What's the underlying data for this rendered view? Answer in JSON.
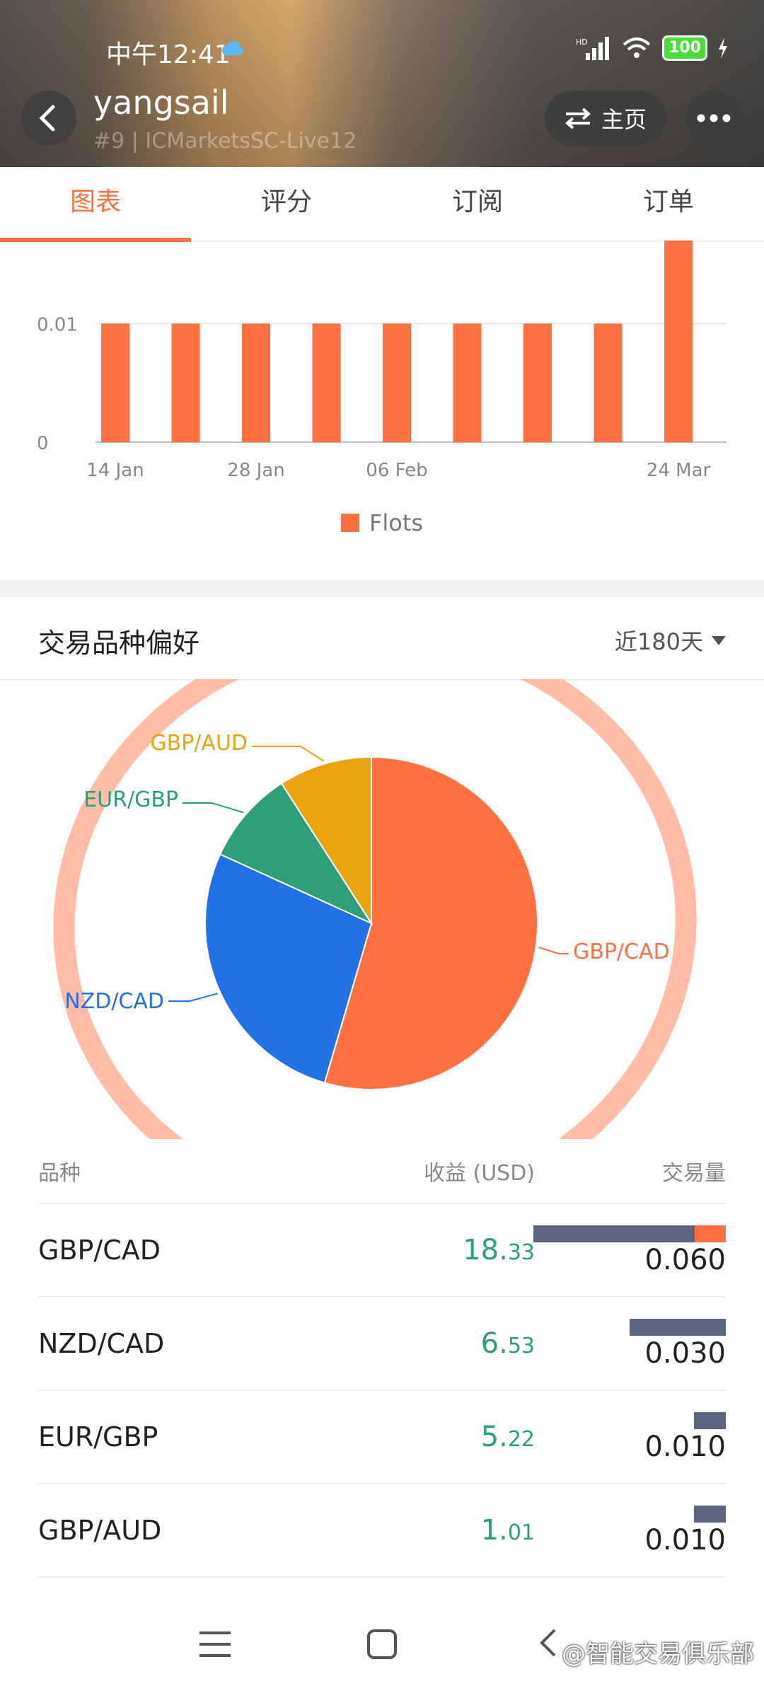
{
  "status_bar": {
    "time": "中午12:41",
    "battery": "100"
  },
  "header": {
    "username": "yangsail",
    "subtitle": "#9 | ICMarketsSC-Live12",
    "home_label": "主页"
  },
  "tabs": [
    {
      "label": "图表",
      "active": true
    },
    {
      "label": "评分",
      "active": false
    },
    {
      "label": "订阅",
      "active": false
    },
    {
      "label": "订单",
      "active": false
    }
  ],
  "bar_chart": {
    "chart_data": {
      "type": "bar",
      "x_tick_labels": [
        "14 Jan",
        "28 Jan",
        "06 Feb",
        "24 Mar"
      ],
      "y_tick_labels": [
        "0",
        "0.01"
      ],
      "values": [
        0.01,
        0.01,
        0.01,
        0.01,
        0.01,
        0.01,
        0.01,
        0.01,
        0.017
      ],
      "series": [
        {
          "name": "Flots",
          "color": "#ff7043"
        }
      ],
      "ylim": [
        0,
        0.017
      ],
      "grid": true,
      "legend": "bottom"
    },
    "legend_label": "Flots"
  },
  "preference": {
    "title": "交易品种偏好",
    "period": "近180天",
    "chart_data": {
      "type": "pie",
      "slices": [
        {
          "label": "GBP/CAD",
          "value": 0.06,
          "color": "#ff7043"
        },
        {
          "label": "NZD/CAD",
          "value": 0.03,
          "color": "#2272e6"
        },
        {
          "label": "EUR/GBP",
          "value": 0.01,
          "color": "#2e9e7a"
        },
        {
          "label": "GBP/AUD",
          "value": 0.01,
          "color": "#e9a40f"
        }
      ]
    }
  },
  "table": {
    "headers": [
      "品种",
      "收益 (USD)",
      "交易量"
    ],
    "rows": [
      {
        "symbol": "GBP/CAD",
        "profit_int": "18.",
        "profit_dec": "33",
        "volume": "0.060",
        "bar_fraction": 1.0,
        "orange_fraction": 0.16
      },
      {
        "symbol": "NZD/CAD",
        "profit_int": "6.",
        "profit_dec": "53",
        "volume": "0.030",
        "bar_fraction": 0.5,
        "orange_fraction": 0
      },
      {
        "symbol": "EUR/GBP",
        "profit_int": "5.",
        "profit_dec": "22",
        "volume": "0.010",
        "bar_fraction": 0.167,
        "orange_fraction": 0
      },
      {
        "symbol": "GBP/AUD",
        "profit_int": "1.",
        "profit_dec": "01",
        "volume": "0.010",
        "bar_fraction": 0.167,
        "orange_fraction": 0
      }
    ]
  },
  "watermark": "@智能交易俱乐部"
}
